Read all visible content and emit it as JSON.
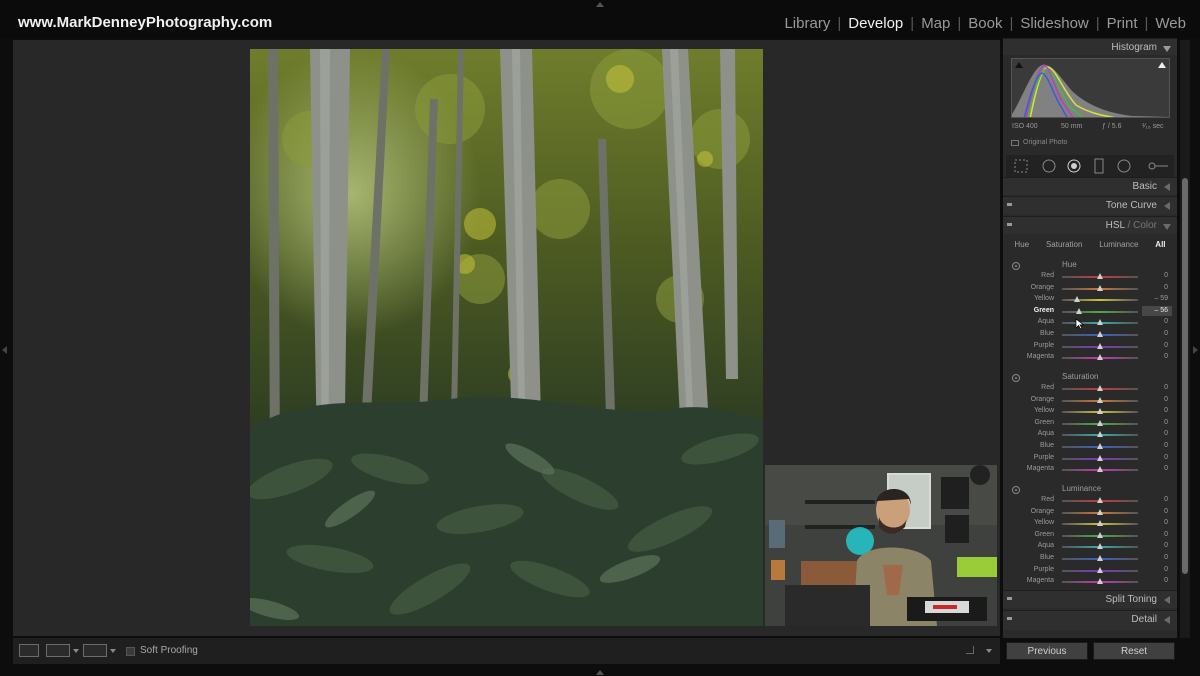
{
  "app": {
    "brand": "www.MarkDenneyPhotography.com",
    "modules": [
      {
        "label": "Library",
        "active": false
      },
      {
        "label": "Develop",
        "active": true
      },
      {
        "label": "Map",
        "active": false
      },
      {
        "label": "Book",
        "active": false
      },
      {
        "label": "Slideshow",
        "active": false
      },
      {
        "label": "Print",
        "active": false
      },
      {
        "label": "Web",
        "active": false
      }
    ]
  },
  "toolbar": {
    "soft_proofing_label": "Soft Proofing",
    "soft_proofing_checked": false
  },
  "histogram": {
    "title": "Histogram",
    "iso": "ISO 400",
    "focal": "50 mm",
    "aperture": "ƒ / 5.6",
    "shutter": "¹⁄₁₆ sec",
    "original_photo_label": "Original Photo"
  },
  "panels": {
    "basic": "Basic",
    "tone_curve": "Tone Curve",
    "hsl": "HSL",
    "color": "Color",
    "split_toning": "Split Toning",
    "detail": "Detail"
  },
  "hsl_tabs": [
    {
      "label": "Hue",
      "active": false
    },
    {
      "label": "Saturation",
      "active": false
    },
    {
      "label": "Luminance",
      "active": false
    },
    {
      "label": "All",
      "active": true
    }
  ],
  "groups": [
    {
      "title": "Hue",
      "rows": [
        {
          "label": "Red",
          "value": "0",
          "pos": 0.5,
          "color": "#c23b3b",
          "highlight": false
        },
        {
          "label": "Orange",
          "value": "0",
          "pos": 0.5,
          "color": "#c8793a",
          "highlight": false
        },
        {
          "label": "Yellow",
          "value": "– 59",
          "pos": 0.2,
          "color": "#c9c23b",
          "highlight": false
        },
        {
          "label": "Green",
          "value": "– 56",
          "pos": 0.22,
          "color": "#4fa845",
          "highlight": true
        },
        {
          "label": "Aqua",
          "value": "0",
          "pos": 0.5,
          "color": "#3aa8a8",
          "highlight": false
        },
        {
          "label": "Blue",
          "value": "0",
          "pos": 0.5,
          "color": "#3a62c2",
          "highlight": false
        },
        {
          "label": "Purple",
          "value": "0",
          "pos": 0.5,
          "color": "#7a3ac2",
          "highlight": false
        },
        {
          "label": "Magenta",
          "value": "0",
          "pos": 0.5,
          "color": "#c23aa8",
          "highlight": false
        }
      ]
    },
    {
      "title": "Saturation",
      "rows": [
        {
          "label": "Red",
          "value": "0",
          "pos": 0.5,
          "color": "#c23b3b",
          "highlight": false
        },
        {
          "label": "Orange",
          "value": "0",
          "pos": 0.5,
          "color": "#c8793a",
          "highlight": false
        },
        {
          "label": "Yellow",
          "value": "0",
          "pos": 0.5,
          "color": "#c9c23b",
          "highlight": false
        },
        {
          "label": "Green",
          "value": "0",
          "pos": 0.5,
          "color": "#4fa845",
          "highlight": false
        },
        {
          "label": "Aqua",
          "value": "0",
          "pos": 0.5,
          "color": "#3aa8a8",
          "highlight": false
        },
        {
          "label": "Blue",
          "value": "0",
          "pos": 0.5,
          "color": "#3a62c2",
          "highlight": false
        },
        {
          "label": "Purple",
          "value": "0",
          "pos": 0.5,
          "color": "#7a3ac2",
          "highlight": false
        },
        {
          "label": "Magenta",
          "value": "0",
          "pos": 0.5,
          "color": "#c23aa8",
          "highlight": false
        }
      ]
    },
    {
      "title": "Luminance",
      "rows": [
        {
          "label": "Red",
          "value": "0",
          "pos": 0.5,
          "color": "#c23b3b",
          "highlight": false
        },
        {
          "label": "Orange",
          "value": "0",
          "pos": 0.5,
          "color": "#c8793a",
          "highlight": false
        },
        {
          "label": "Yellow",
          "value": "0",
          "pos": 0.5,
          "color": "#c9c23b",
          "highlight": false
        },
        {
          "label": "Green",
          "value": "0",
          "pos": 0.5,
          "color": "#4fa845",
          "highlight": false
        },
        {
          "label": "Aqua",
          "value": "0",
          "pos": 0.5,
          "color": "#3aa8a8",
          "highlight": false
        },
        {
          "label": "Blue",
          "value": "0",
          "pos": 0.5,
          "color": "#3a62c2",
          "highlight": false
        },
        {
          "label": "Purple",
          "value": "0",
          "pos": 0.5,
          "color": "#7a3ac2",
          "highlight": false
        },
        {
          "label": "Magenta",
          "value": "0",
          "pos": 0.5,
          "color": "#c23aa8",
          "highlight": false
        }
      ]
    }
  ],
  "buttons": {
    "previous": "Previous",
    "reset": "Reset"
  }
}
